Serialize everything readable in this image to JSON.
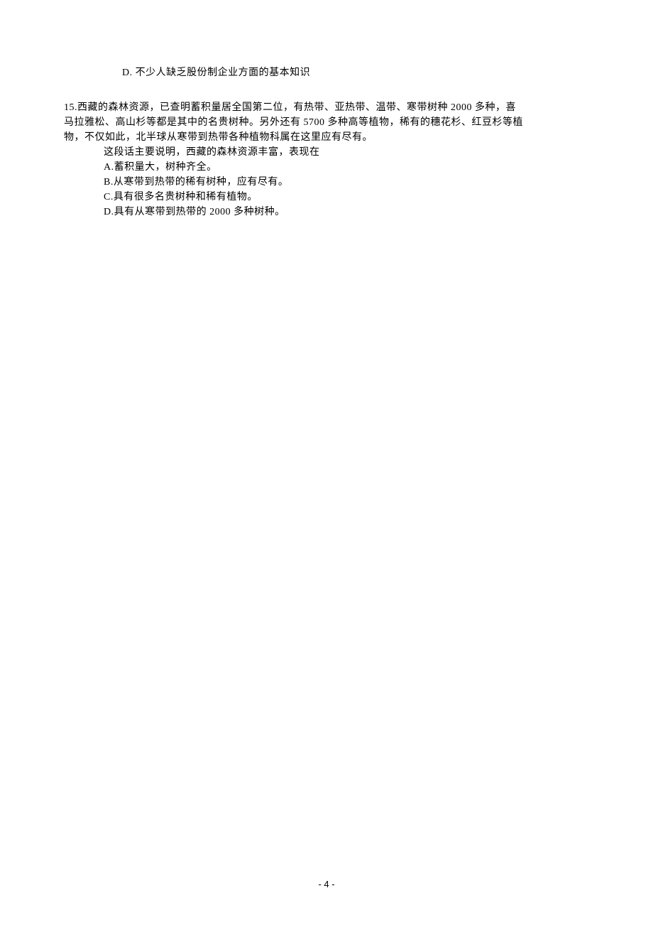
{
  "prev_question": {
    "option_d": "D. 不少人缺乏股份制企业方面的基本知识"
  },
  "question_15": {
    "number": "15.",
    "text_line1": "15.西藏的森林资源，已查明蓄积量居全国第二位，有热带、亚热带、温带、寒带树种 2000 多种，喜",
    "text_line2": "马拉雅松、高山杉等都是其中的名贵树种。另外还有 5700 多种高等植物，稀有的穗花杉、红豆杉等植",
    "text_line3": "物，不仅如此，北半球从寒带到热带各种植物科属在这里应有尽有。",
    "prompt": "这段话主要说明，西藏的森林资源丰富，表现在",
    "option_a": "A.蓄积量大，树种齐全。",
    "option_b": "B.从寒带到热带的稀有树种，应有尽有。",
    "option_c": "C.具有很多名贵树种和稀有植物。",
    "option_d": "D.具有从寒带到热带的 2000 多种树种。"
  },
  "page_number": "- 4 -"
}
